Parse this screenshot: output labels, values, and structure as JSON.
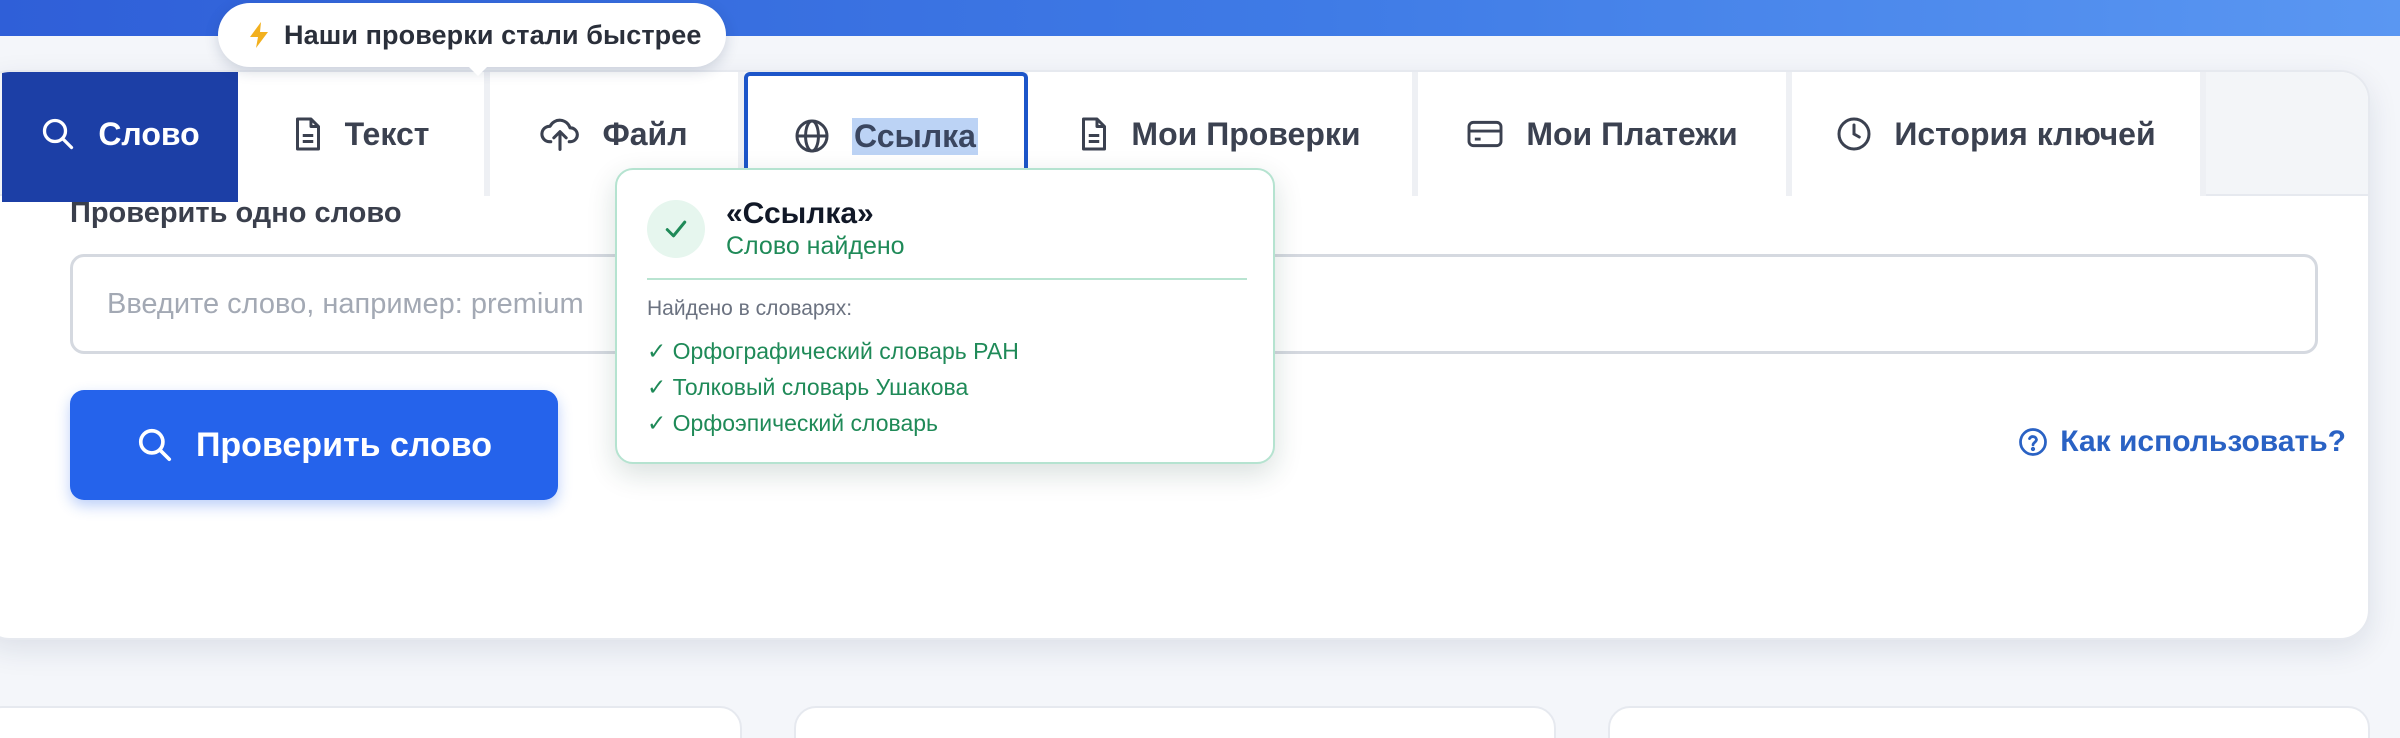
{
  "promo": {
    "icon": "lightning-icon",
    "text": "Наши проверки стали быстрее"
  },
  "tabs": [
    {
      "label": "Слово",
      "icon": "search-icon",
      "active": true
    },
    {
      "label": "Текст",
      "icon": "document-icon"
    },
    {
      "label": "Файл",
      "icon": "upload-cloud-icon"
    },
    {
      "label": "Ссылка",
      "icon": "globe-icon",
      "focused": true,
      "text_selected": true
    },
    {
      "label": "Мои Проверки",
      "icon": "document-icon"
    },
    {
      "label": "Мои Платежи",
      "icon": "credit-card-icon"
    },
    {
      "label": "История ключей",
      "icon": "clock-icon"
    }
  ],
  "form": {
    "label": "Проверить одно слово",
    "input_value": "",
    "input_placeholder": "Введите слово, например: premium",
    "button_label": "Проверить слово",
    "help_label": "Как использовать?"
  },
  "popover": {
    "title": "«Ссылка»",
    "status": "Слово найдено",
    "found_label": "Найдено в словарях:",
    "dictionaries": [
      "✓ Орфографический словарь РАН",
      "✓ Толковый словарь Ушакова",
      "✓ Орфоэпический словарь"
    ]
  },
  "colors": {
    "accent": "#2563eb",
    "active_tab": "#1c3fa6",
    "success": "#1f8a58",
    "link": "#2a62c4",
    "promo_bolt": "#f2b01e"
  }
}
